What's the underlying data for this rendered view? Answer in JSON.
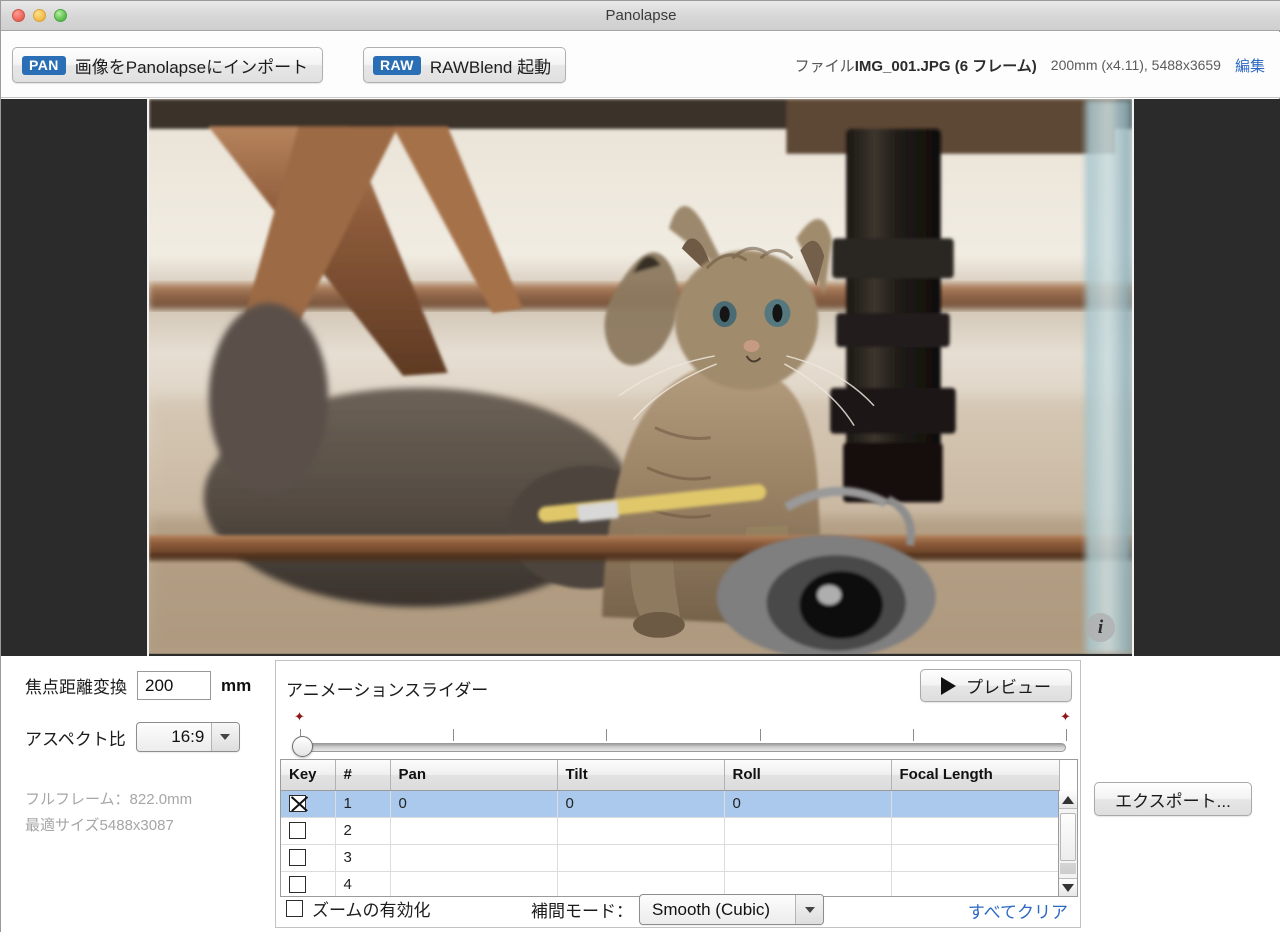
{
  "window": {
    "title": "Panolapse"
  },
  "traffic_lights": {
    "close": "close",
    "minimize": "minimize",
    "zoom": "zoom"
  },
  "toolbar": {
    "import_badge": "PAN",
    "import_label": "画像をPanolapseにインポート",
    "rawblend_badge": "RAW",
    "rawblend_label": "RAWBlend 起動",
    "file_prefix": "ファイル",
    "file_name": "IMG_001.JPG (6 フレーム)",
    "dimensions": "200mm (x4.11), 5488x3659",
    "edit_link": "編集"
  },
  "viewer": {
    "info_icon": "i"
  },
  "settings": {
    "focal_label": "焦点距離変換",
    "focal_value": "200",
    "focal_unit": "mm",
    "aspect_label": "アスペクト比",
    "aspect_value": "16:9",
    "hint_fullframe": "フルフレーム：822.0mm",
    "hint_optimal": "最適サイズ5488x3087"
  },
  "animation": {
    "title": "アニメーションスライダー",
    "preview_label": "プレビュー",
    "slider": {
      "value": 0,
      "min": 0,
      "max": 100,
      "ticks": [
        0,
        20,
        40,
        60,
        80,
        100
      ]
    }
  },
  "table": {
    "headers": [
      "Key",
      "#",
      "Pan",
      "Tilt",
      "Roll",
      "Focal Length"
    ],
    "rows": [
      {
        "key": true,
        "num": "1",
        "pan": "0",
        "tilt": "0",
        "roll": "0",
        "focal": "",
        "selected": true
      },
      {
        "key": false,
        "num": "2",
        "pan": "",
        "tilt": "",
        "roll": "",
        "focal": "",
        "selected": false
      },
      {
        "key": false,
        "num": "3",
        "pan": "",
        "tilt": "",
        "roll": "",
        "focal": "",
        "selected": false
      },
      {
        "key": false,
        "num": "4",
        "pan": "",
        "tilt": "",
        "roll": "",
        "focal": "",
        "selected": false
      }
    ]
  },
  "footer": {
    "zoom_enable_label": "ズームの有効化",
    "zoom_enable_checked": false,
    "interp_label": "補間モード：",
    "interp_value": "Smooth (Cubic)",
    "clear_all": "すべてクリア"
  },
  "export": {
    "label": "エクスポート..."
  },
  "colors": {
    "accent_blue": "#2a6fb5",
    "link_blue": "#2d68c4",
    "selection": "#aac9ec",
    "star_red": "#8e1616"
  }
}
